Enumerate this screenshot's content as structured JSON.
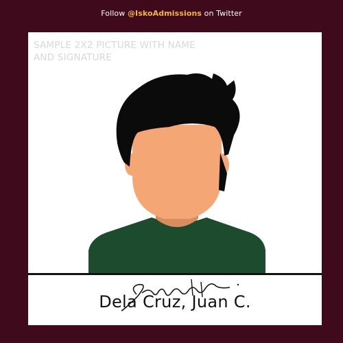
{
  "banner": {
    "prefix": "Follow ",
    "handle": "@IskoAdmissions",
    "suffix": " on Twitter"
  },
  "card": {
    "sample_label": "SAMPLE 2X2 PICTURE WITH NAME AND SIGNATURE",
    "name": "Dela Cruz, Juan C.",
    "signature_text": "Signature"
  },
  "colors": {
    "background": "#3e0a1c",
    "handle_accent": "#f5b53f",
    "skin": "#f4a674",
    "neck_shadow": "#d98c5d",
    "hair": "#0b0b0b",
    "shirt": "#1d4b2d"
  },
  "icons": {
    "avatar": "faceless-male-avatar",
    "signature": "handwritten-signature"
  }
}
